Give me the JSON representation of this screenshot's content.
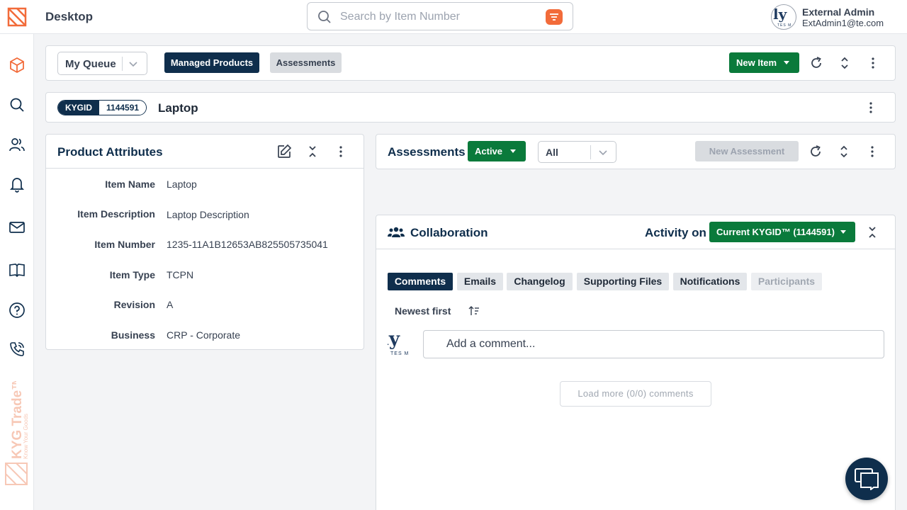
{
  "header": {
    "title": "Desktop",
    "search_placeholder": "Search by Item Number",
    "user": {
      "name": "External Admin",
      "email": "ExtAdmin1@te.com",
      "avatar_text": "ly",
      "avatar_sub": "TES M"
    }
  },
  "sidebar": {
    "items": [
      "products",
      "search",
      "users",
      "notifications",
      "mail",
      "guide",
      "help",
      "phone"
    ],
    "brand": "KYG Trade™",
    "brand_tagline": "Know Your Goods"
  },
  "queue_bar": {
    "queue_select": "My Queue",
    "tabs": [
      "Managed Products",
      "Assessments"
    ],
    "new_item": "New Item"
  },
  "item_bar": {
    "kygid_label": "KYGID",
    "kygid_value": "1144591",
    "item_title": "Laptop"
  },
  "product_attributes": {
    "title": "Product Attributes",
    "rows": [
      {
        "label": "Item Name",
        "value": "Laptop"
      },
      {
        "label": "Item Description",
        "value": "Laptop Description"
      },
      {
        "label": "Item Number",
        "value": "1235-11A1B12653AB825505735041"
      },
      {
        "label": "Item Type",
        "value": "TCPN"
      },
      {
        "label": "Revision",
        "value": "A"
      },
      {
        "label": "Business",
        "value": "CRP - Corporate"
      }
    ]
  },
  "assessments": {
    "title": "Assessments",
    "status": "Active",
    "filter": "All",
    "new_assessment": "New Assessment"
  },
  "collaboration": {
    "title": "Collaboration",
    "activity_label": "Activity on",
    "activity_select": "Current KYGID™ (1144591)",
    "tabs": [
      "Comments",
      "Emails",
      "Changelog",
      "Supporting Files",
      "Notifications",
      "Participants"
    ],
    "sort_label": "Newest first",
    "comment_placeholder": "Add a comment...",
    "load_more": "Load more (0/0) comments",
    "avatar_text": "ly",
    "avatar_sub": "TES M"
  },
  "colors": {
    "primary_dark": "#0f2e4c",
    "accent_green": "#0a7a3b",
    "brand_orange": "#f26b3a"
  }
}
